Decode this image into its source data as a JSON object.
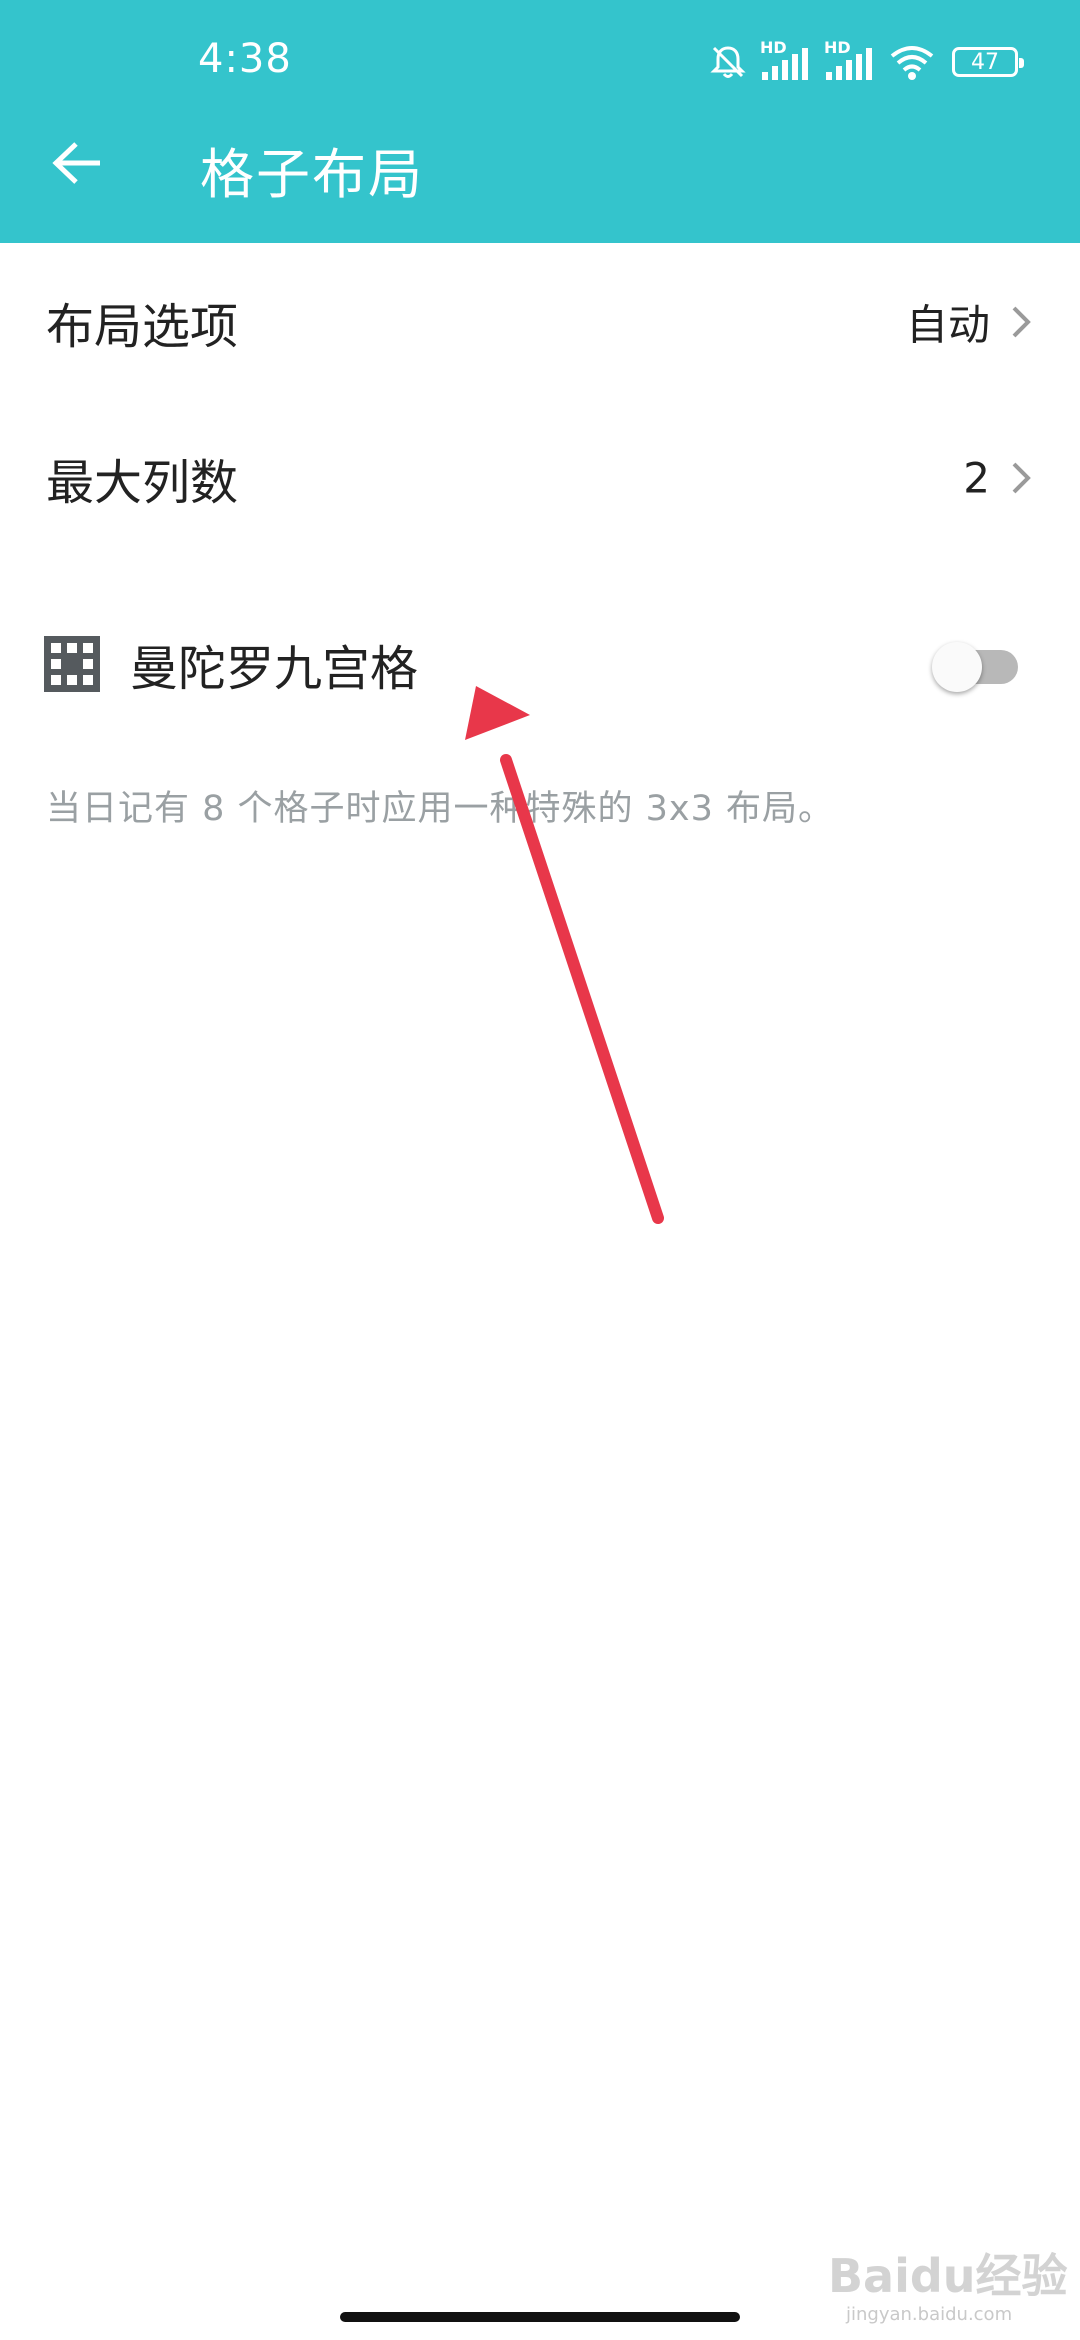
{
  "status_bar": {
    "time": "4:38",
    "battery": "47",
    "network_label_1": "HD",
    "network_label_2": "HD",
    "icons": [
      "bell-off-icon",
      "signal-icon",
      "signal-icon",
      "wifi-icon",
      "battery-icon"
    ]
  },
  "app_bar": {
    "title": "格子布局",
    "background_color": "#34c4cc",
    "back_icon": "arrow-left-icon"
  },
  "settings": {
    "layout_option": {
      "label": "布局选项",
      "value": "自动"
    },
    "max_columns": {
      "label": "最大列数",
      "value": "2"
    },
    "mandala": {
      "label": "曼陀罗九宫格",
      "icon": "grid-icon",
      "enabled": false,
      "description": "当日记有 8 个格子时应用一种特殊的 3x3 布局。"
    }
  },
  "annotation": {
    "arrow_color": "#e8374a"
  },
  "watermark": {
    "text": "Baidu经验",
    "url": "jingyan.baidu.com"
  }
}
